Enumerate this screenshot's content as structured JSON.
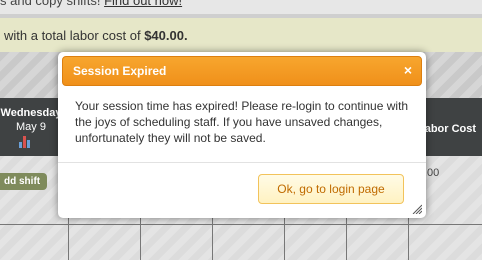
{
  "background": {
    "top_text": "s and copy shifts! ",
    "top_link": "Find out how!",
    "banner_prefix": "with a total labor cost of ",
    "banner_amount": "$40.00.",
    "day_name": "Wednesday",
    "day_date": "May 9",
    "labor_cost_header": "Labor Cost",
    "add_shift_label": "dd shift",
    "amount": ".00"
  },
  "modal": {
    "title": "Session Expired",
    "close_symbol": "×",
    "message": "Your session time has expired! Please re-login to continue with the joys of scheduling staff. If you have unsaved changes, unfortunately they will not be saved.",
    "button_label": "Ok, go to login page"
  },
  "colors": {
    "header_orange": "#f0901a",
    "button_text": "#c06b00",
    "toolbar_dark": "#3f4243"
  },
  "icons": [
    "chart-bars-icon",
    "close-icon",
    "resize-grip-icon"
  ]
}
